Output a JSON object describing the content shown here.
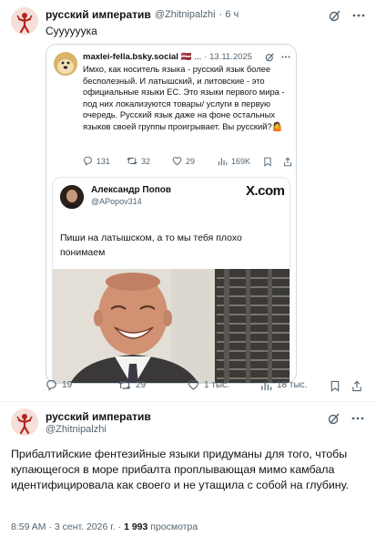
{
  "tweet1": {
    "display_name": "русский императив",
    "handle": "@Zhitnipalzhi",
    "time": "· 6 ч",
    "text": "Суууууука",
    "quote": {
      "handle": "maxlei-fella.bsky.social",
      "flags": "🇱🇻 ...",
      "date": "· 13.11.2025",
      "text": "Имхо, как носитель языка - русский язык более бесполезный. И латышский, и литовские - это официальные языки ЕС. Это языки первого мира - под них локализуются товары/ услуги в первую очередь. Русский язык даже на фоне остальных языков своей группы проигрывает. Вы русский?🤷",
      "actions": {
        "replies": "131",
        "reposts": "32",
        "likes": "29",
        "views": "169K"
      },
      "nested": {
        "name": "Александр Попов",
        "handle": "@APopov314",
        "logo": "X.com",
        "text": "Пиши на латышском, а то мы тебя плохо понимаем"
      }
    },
    "actions": {
      "replies": "19",
      "reposts": "29",
      "likes": "1 тыс.",
      "views": "18 тыс."
    }
  },
  "tweet2": {
    "display_name": "русский императив",
    "handle": "@Zhitnipalzhi",
    "text": "Прибалтийские фентезийные языки придуманы для того, чтобы купающегося в море прибалта проплывающая мимо камбала идентифицировала как своего и не утащила с собой на глубину.",
    "timestamp": "8:59 AM · 3 сент. 2026 г. · ",
    "views_count": "1 993",
    "views_label": " просмотра"
  },
  "icons": [
    "avatar-icon",
    "grok-icon",
    "more-icon",
    "reply-icon",
    "repost-icon",
    "like-icon",
    "views-icon",
    "bookmark-icon",
    "share-icon",
    "verified-icon"
  ]
}
